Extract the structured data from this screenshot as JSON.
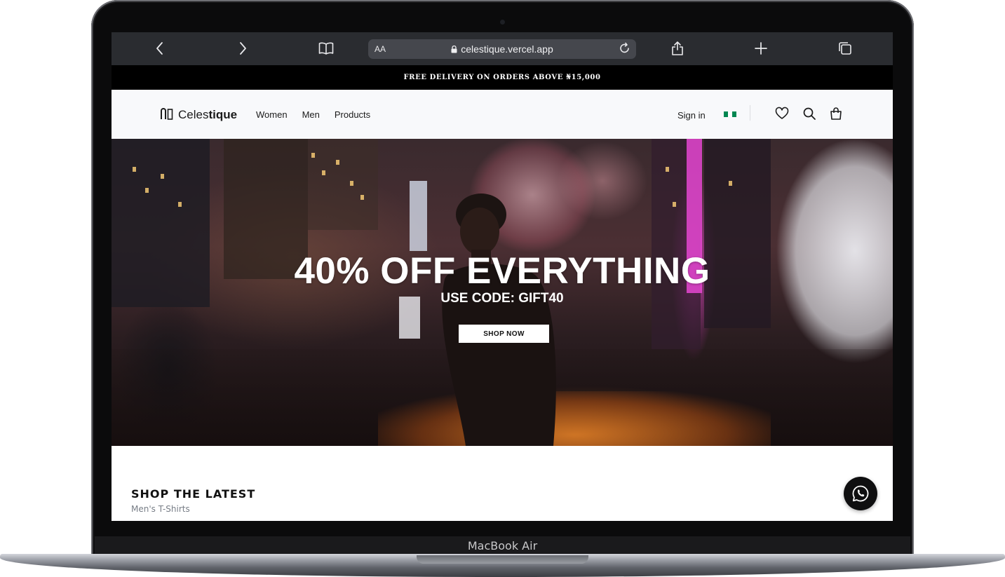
{
  "device": {
    "label": "MacBook Air"
  },
  "browser": {
    "text_size_label": "AA",
    "url": "celestique.vercel.app",
    "icons": [
      "back-icon",
      "forward-icon",
      "bookmarks-icon",
      "lock-icon",
      "reload-icon",
      "share-icon",
      "new-tab-icon",
      "tabs-icon"
    ]
  },
  "promo": {
    "text": "FREE DELIVERY ON ORDERS ABOVE ₦15,000"
  },
  "header": {
    "logo_light": "Celes",
    "logo_bold": "tique",
    "nav": [
      "Women",
      "Men",
      "Products"
    ],
    "sign_in": "Sign in",
    "flag_colors": [
      "#008751",
      "#ffffff",
      "#008751"
    ],
    "icons": [
      "heart-icon",
      "search-icon",
      "bag-icon"
    ]
  },
  "hero": {
    "title": "40% OFF EVERYTHING",
    "subtitle": "USE CODE: GIFT40",
    "cta": "SHOP NOW"
  },
  "section": {
    "title": "SHOP THE LATEST",
    "subtitle": "Men's T-Shirts"
  },
  "floating": {
    "icon": "whatsapp-icon"
  }
}
